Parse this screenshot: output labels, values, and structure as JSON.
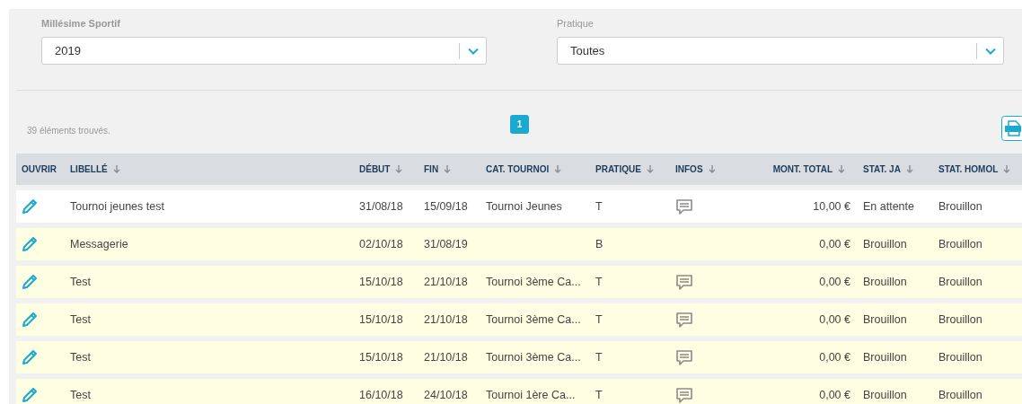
{
  "filters": [
    {
      "label": "Millésime Sportif",
      "value": "2019"
    },
    {
      "label": "Pratique",
      "value": "Toutes"
    }
  ],
  "results_count": "39 éléments trouvés.",
  "pagination": [
    {
      "label": "1",
      "selected": true
    }
  ],
  "table": {
    "columns": [
      {
        "label": "OUVRIR",
        "sortable": false
      },
      {
        "label": "LIBELLÉ",
        "sortable": true
      },
      {
        "label": "DÉBUT",
        "sortable": true
      },
      {
        "label": "FIN",
        "sortable": true
      },
      {
        "label": "CAT. TOURNOI",
        "sortable": true
      },
      {
        "label": "PRATIQUE",
        "sortable": true
      },
      {
        "label": "INFOS",
        "sortable": true
      },
      {
        "label": "MONT. TOTAL",
        "sortable": true
      },
      {
        "label": "STAT. JA",
        "sortable": true
      },
      {
        "label": "STAT. HOMOL",
        "sortable": true
      }
    ],
    "rows": [
      {
        "highlighted": false,
        "libelle": "Tournoi jeunes test",
        "debut": "31/08/18",
        "fin": "15/09/18",
        "categorie": "Tournoi Jeunes",
        "pratique": "T",
        "has_info": true,
        "montant": "10,00 €",
        "stat_ja": "En attente",
        "stat_homol": "Brouillon"
      },
      {
        "highlighted": true,
        "libelle": "Messagerie",
        "debut": "02/10/18",
        "fin": "31/08/19",
        "categorie": "",
        "pratique": "B",
        "has_info": false,
        "montant": "0,00 €",
        "stat_ja": "Brouillon",
        "stat_homol": "Brouillon"
      },
      {
        "highlighted": true,
        "libelle": "Test",
        "debut": "15/10/18",
        "fin": "21/10/18",
        "categorie": "Tournoi 3ème Ca...",
        "pratique": "T",
        "has_info": true,
        "montant": "0,00 €",
        "stat_ja": "Brouillon",
        "stat_homol": "Brouillon"
      },
      {
        "highlighted": true,
        "libelle": "Test",
        "debut": "15/10/18",
        "fin": "21/10/18",
        "categorie": "Tournoi 3ème Ca...",
        "pratique": "T",
        "has_info": true,
        "montant": "0,00 €",
        "stat_ja": "Brouillon",
        "stat_homol": "Brouillon"
      },
      {
        "highlighted": true,
        "libelle": "Test",
        "debut": "15/10/18",
        "fin": "21/10/18",
        "categorie": "Tournoi 3ème Ca...",
        "pratique": "T",
        "has_info": true,
        "montant": "0,00 €",
        "stat_ja": "Brouillon",
        "stat_homol": "Brouillon"
      },
      {
        "highlighted": true,
        "libelle": "Test",
        "debut": "16/10/18",
        "fin": "24/10/18",
        "categorie": "Tournoi 1ère Ca...",
        "pratique": "T",
        "has_info": true,
        "montant": "0,00 €",
        "stat_ja": "Brouillon",
        "stat_homol": "Brouillon"
      }
    ]
  }
}
